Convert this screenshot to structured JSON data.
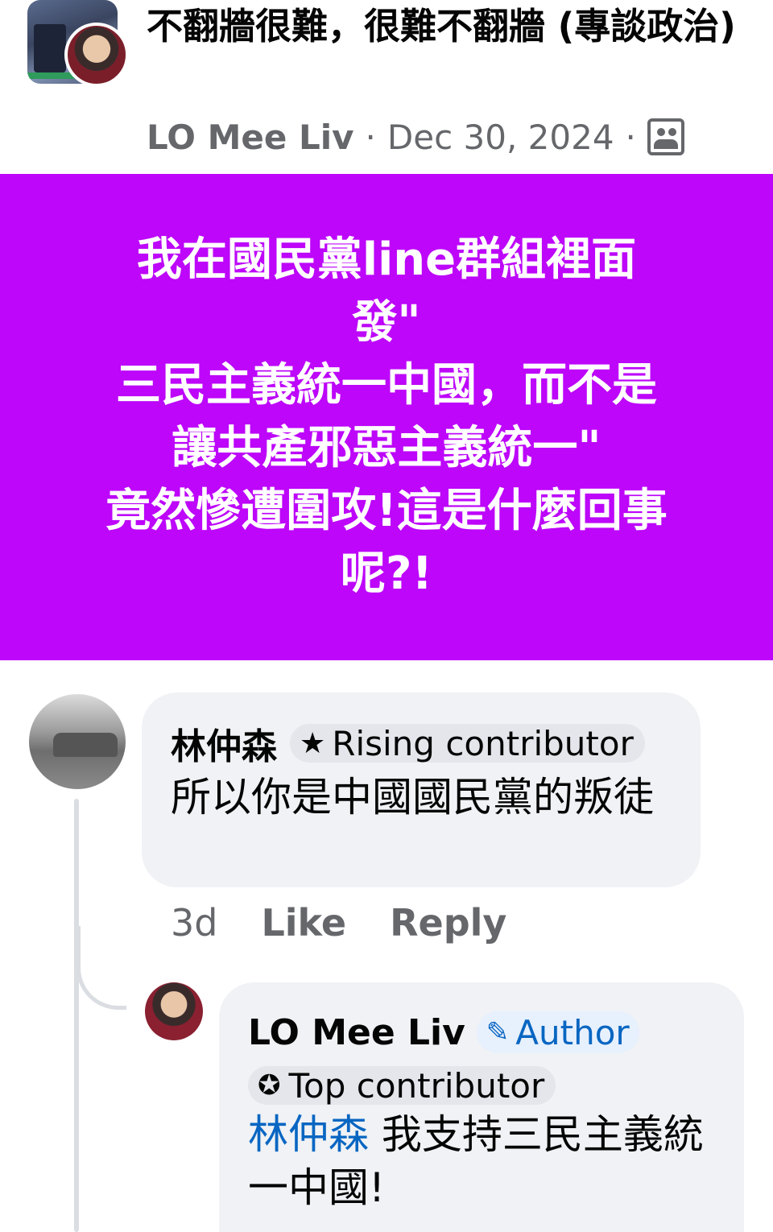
{
  "group": {
    "title": "不翻牆很難，很難不翻牆 (專談政治)",
    "author": "LO Mee Liv",
    "separator": "·",
    "date": "Dec 30, 2024",
    "privacy_icon": "group-members-icon"
  },
  "post": {
    "text": "我在國民黨line群組裡面\n發\"\n三民主義統一中國，而不是\n讓共產邪惡主義統一\"\n竟然慘遭圍攻!這是什麼回事\n呢?!",
    "background_color": "#bd06fa",
    "text_color": "#ffffff"
  },
  "comment": {
    "name": "林仲森",
    "badge_icon": "star-icon",
    "badge_label": "Rising contributor",
    "text": "所以你是中國國民黨的叛徒",
    "time": "3d",
    "like_label": "Like",
    "reply_label": "Reply"
  },
  "reply": {
    "name": "LO Mee Liv",
    "author_badge_icon": "pencil-icon",
    "author_badge_label": "Author",
    "top_badge_icon": "medal-icon",
    "top_badge_label": "Top contributor",
    "mention": "林仲森",
    "text": " 我支持三民主義統一中國!"
  },
  "colors": {
    "link": "#0866c2",
    "secondary_text": "#65676b",
    "bubble": "#f0f2f5"
  }
}
